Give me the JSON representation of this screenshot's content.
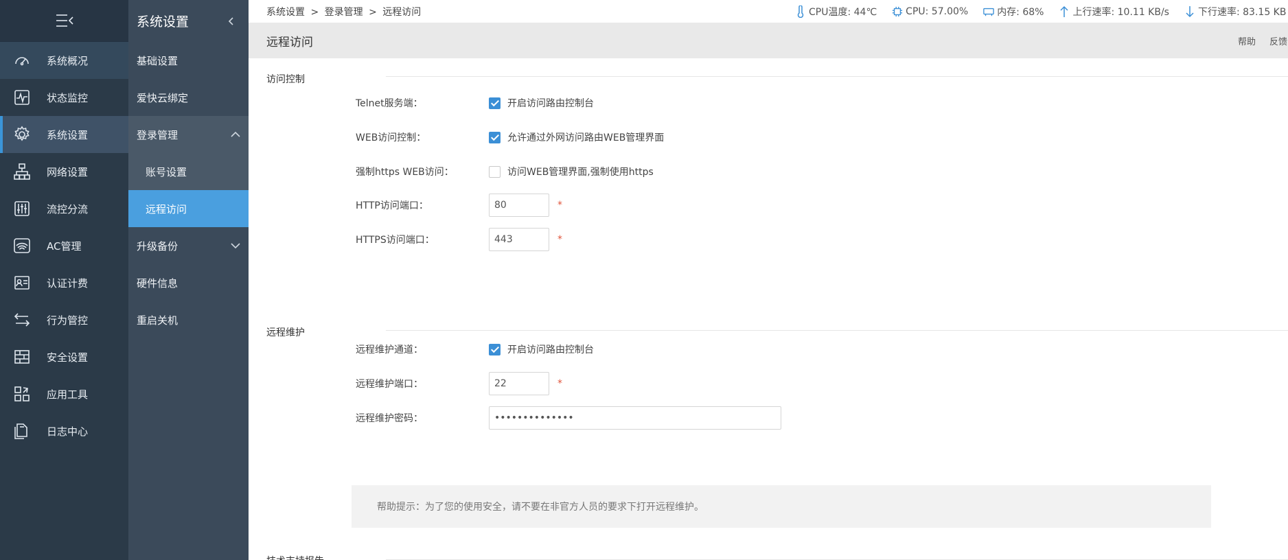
{
  "sidebar": {
    "menu_icon": "menu-collapse-icon",
    "items": [
      {
        "label": "系统概况",
        "icon": "dashboard-gauge-icon"
      },
      {
        "label": "状态监控",
        "icon": "monitor-pulse-icon"
      },
      {
        "label": "系统设置",
        "icon": "gear-icon"
      },
      {
        "label": "网络设置",
        "icon": "network-tree-icon"
      },
      {
        "label": "流控分流",
        "icon": "sliders-icon"
      },
      {
        "label": "AC管理",
        "icon": "wifi-router-icon"
      },
      {
        "label": "认证计费",
        "icon": "id-card-icon"
      },
      {
        "label": "行为管控",
        "icon": "swap-arrows-icon"
      },
      {
        "label": "安全设置",
        "icon": "firewall-icon"
      },
      {
        "label": "应用工具",
        "icon": "apps-grid-icon"
      },
      {
        "label": "日志中心",
        "icon": "document-copy-icon"
      }
    ]
  },
  "submenu": {
    "title": "系统设置",
    "items": [
      {
        "label": "基础设置"
      },
      {
        "label": "爱快云绑定"
      },
      {
        "label": "登录管理"
      },
      {
        "label": "账号设置"
      },
      {
        "label": "远程访问"
      },
      {
        "label": "升级备份"
      },
      {
        "label": "硬件信息"
      },
      {
        "label": "重启关机"
      }
    ]
  },
  "breadcrumb": {
    "parts": [
      "系统设置",
      ">",
      "登录管理",
      ">",
      "远程访问"
    ]
  },
  "stats": {
    "cpu_temp": "CPU温度: 44℃",
    "cpu": "CPU: 57.00%",
    "mem": "内存: 68%",
    "up": "上行速率: 10.11 KB/s",
    "down": "下行速率: 83.15 KB"
  },
  "page": {
    "title": "远程访问",
    "help_link": "帮助",
    "feedback_link": "反馈"
  },
  "access": {
    "section": "访问控制",
    "telnet_label": "Telnet服务端：",
    "telnet_text": "开启访问路由控制台",
    "telnet_checked": true,
    "web_label": "WEB访问控制：",
    "web_text": "允许通过外网访问路由WEB管理界面",
    "web_checked": true,
    "https_label": "强制https WEB访问：",
    "https_text": "访问WEB管理界面,强制使用https",
    "https_checked": false,
    "http_port_label": "HTTP访问端口：",
    "http_port": "80",
    "https_port_label": "HTTPS访问端口：",
    "https_port": "443",
    "required_mark": "*"
  },
  "remote": {
    "section": "远程维护",
    "channel_label": "远程维护通道：",
    "channel_text": "开启访问路由控制台",
    "channel_checked": true,
    "port_label": "远程维护端口：",
    "port": "22",
    "password_label": "远程维护密码：",
    "password": "••••••••••••••"
  },
  "help": {
    "text": "帮助提示：为了您的使用安全，请不要在非官方人员的要求下打开远程维护。"
  },
  "next_section": {
    "title": "技术支持报告"
  },
  "colors": {
    "sidebar_bg": "#2b3a48",
    "submenu_bg": "#3b4a5a",
    "accent": "#4a9fdf",
    "checkbox": "#3b8fd6",
    "required": "#e0553c"
  }
}
